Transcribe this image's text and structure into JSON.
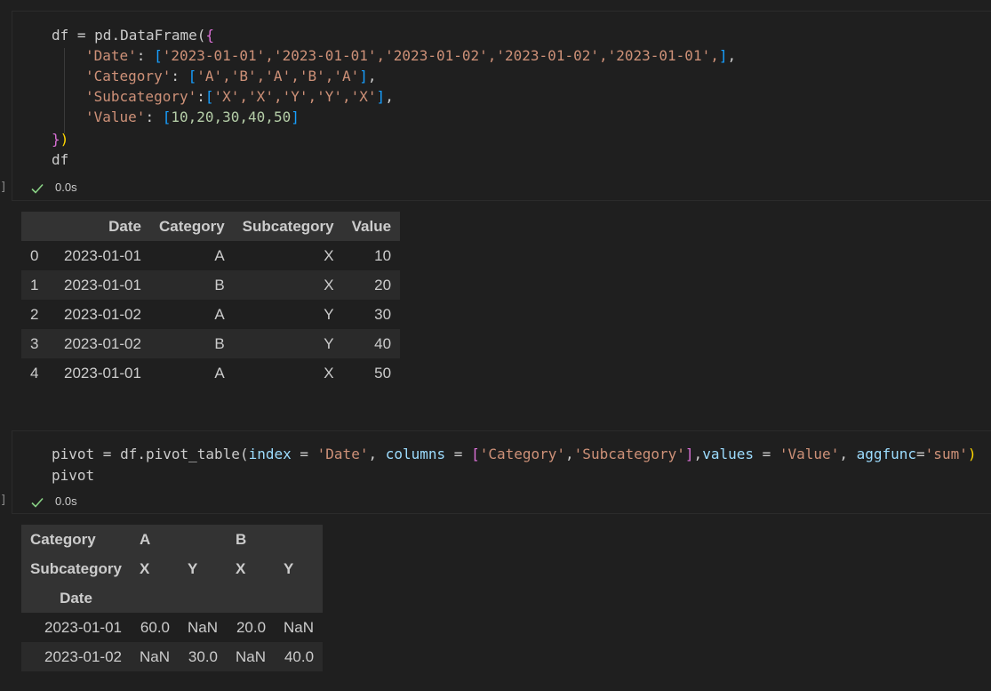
{
  "cell1": {
    "exec_count": "]",
    "status_time": "0.0s",
    "code": {
      "l1_var": "df",
      "l1_eq": " = ",
      "l1_call": "pd.DataFrame(",
      "l1_brace": "{",
      "l2_key": "'Date'",
      "l2_colon": ": ",
      "l2_open": "[",
      "l2_items": "'2023-01-01','2023-01-01','2023-01-02','2023-01-02','2023-01-01',",
      "l2_close": "]",
      "l2_comma": ",",
      "l3_key": "'Category'",
      "l3_colon": ": ",
      "l3_open": "[",
      "l3_items": "'A','B','A','B','A'",
      "l3_close": "]",
      "l3_comma": ",",
      "l4_key": "'Subcategory'",
      "l4_colon": ":",
      "l4_open": "[",
      "l4_items": "'X','X','Y','Y','X'",
      "l4_close": "]",
      "l4_comma": ",",
      "l5_key": "'Value'",
      "l5_colon": ": ",
      "l5_open": "[",
      "l5_items": "10,20,30,40,50",
      "l5_close": "]",
      "l6_brace": "}",
      "l6_paren": ")",
      "l7": "df"
    }
  },
  "table1": {
    "headers": [
      "",
      "Date",
      "Category",
      "Subcategory",
      "Value"
    ],
    "rows": [
      [
        "0",
        "2023-01-01",
        "A",
        "X",
        "10"
      ],
      [
        "1",
        "2023-01-01",
        "B",
        "X",
        "20"
      ],
      [
        "2",
        "2023-01-02",
        "A",
        "Y",
        "30"
      ],
      [
        "3",
        "2023-01-02",
        "B",
        "Y",
        "40"
      ],
      [
        "4",
        "2023-01-01",
        "A",
        "X",
        "50"
      ]
    ]
  },
  "cell2": {
    "exec_count": "]",
    "status_time": "0.0s",
    "code": {
      "a_var": "pivot",
      "a_eq": " = ",
      "a_call": "df.pivot_table(",
      "a_p1": "index",
      "a_eq1": " = ",
      "a_s1": "'Date'",
      "a_c1": ", ",
      "a_p2": "columns",
      "a_eq2": " = ",
      "a_open": "[",
      "a_s2": "'Category'",
      "a_c2": ",",
      "a_s3": "'Subcategory'",
      "a_close": "]",
      "a_c3": ",",
      "a_p3": "values",
      "a_eq3": " = ",
      "a_s4": "'Value'",
      "a_c4": ", ",
      "a_p4": "aggfunc",
      "a_eq4": "=",
      "a_s5": "'sum'",
      "a_paren": ")",
      "b": "pivot"
    }
  },
  "table2": {
    "header_row1": [
      "Category",
      "A",
      "",
      "B",
      ""
    ],
    "header_row2": [
      "Subcategory",
      "X",
      "Y",
      "X",
      "Y"
    ],
    "header_row3": [
      "Date",
      "",
      "",
      "",
      ""
    ],
    "rows": [
      [
        "2023-01-01",
        "60.0",
        "NaN",
        "20.0",
        "NaN"
      ],
      [
        "2023-01-02",
        "NaN",
        "30.0",
        "NaN",
        "40.0"
      ]
    ]
  },
  "colors": {
    "background": "#1f1f1f",
    "string": "#ce9178",
    "number": "#b5cea8",
    "param": "#9cdcfe",
    "bracket_gold": "#ffd700",
    "bracket_purple": "#da70d6",
    "bracket_blue": "#179fff",
    "success_check": "#89d185"
  },
  "icons": {
    "status": "check-icon"
  }
}
